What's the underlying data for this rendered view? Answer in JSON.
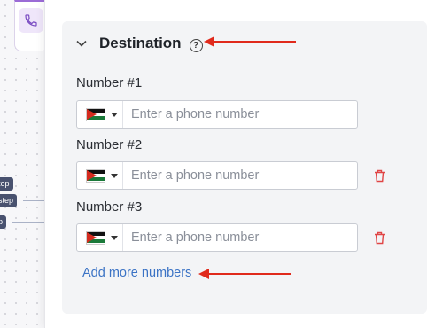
{
  "workflow_canvas": {
    "step_tags": [
      "tep",
      "step",
      "p"
    ]
  },
  "destination": {
    "title": "Destination",
    "help_glyph": "?",
    "fields": [
      {
        "label": "Number #1",
        "placeholder": "Enter a phone number",
        "deletable": false
      },
      {
        "label": "Number #2",
        "placeholder": "Enter a phone number",
        "deletable": true
      },
      {
        "label": "Number #3",
        "placeholder": "Enter a phone number",
        "deletable": true
      }
    ],
    "add_more_label": "Add more numbers"
  },
  "colors": {
    "accent_link": "#3b73c5",
    "delete_icon": "#e04545",
    "annotation_arrow": "#e02a1c",
    "card_bg": "#f3f4f6",
    "node_accent": "#9b6bd6"
  },
  "icons": {
    "collapse": "chevron-down-icon",
    "help": "question-circle-icon",
    "country_flag": "jordan-flag-icon",
    "dropdown": "caret-down-icon",
    "delete": "trash-icon",
    "phone": "phone-icon"
  }
}
